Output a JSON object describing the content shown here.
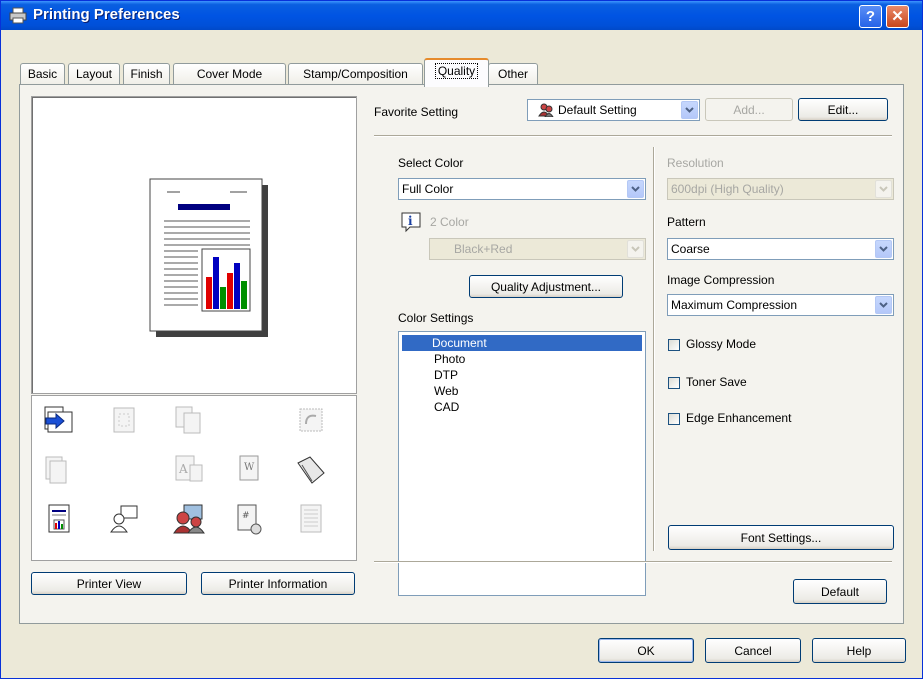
{
  "window": {
    "title": "Printing Preferences",
    "help_btn": "?",
    "close_btn": "✕"
  },
  "tabs": [
    {
      "label": "Basic"
    },
    {
      "label": "Layout"
    },
    {
      "label": "Finish"
    },
    {
      "label": "Cover Mode"
    },
    {
      "label": "Stamp/Composition"
    },
    {
      "label": "Quality",
      "active": true
    },
    {
      "label": "Other"
    }
  ],
  "favorite": {
    "label": "Favorite Setting",
    "value": "Default Setting",
    "add_btn": "Add...",
    "edit_btn": "Edit..."
  },
  "select_color": {
    "label": "Select Color",
    "value": "Full Color"
  },
  "two_color": {
    "label": "2 Color",
    "value": "Black+Red"
  },
  "quality_adjustment_btn": "Quality Adjustment...",
  "color_settings": {
    "label": "Color Settings",
    "items": [
      "Document",
      "Photo",
      "DTP",
      "Web",
      "CAD"
    ],
    "selected": "Document"
  },
  "resolution": {
    "label": "Resolution",
    "value": "600dpi (High Quality)"
  },
  "pattern": {
    "label": "Pattern",
    "value": "Coarse"
  },
  "image_compression": {
    "label": "Image Compression",
    "value": "Maximum Compression"
  },
  "checkboxes": {
    "glossy": "Glossy Mode",
    "toner_save": "Toner Save",
    "edge": "Edge Enhancement"
  },
  "font_settings_btn": "Font Settings...",
  "default_btn": "Default",
  "printer_view_btn": "Printer View",
  "printer_info_btn": "Printer Information",
  "footer": {
    "ok": "OK",
    "cancel": "Cancel",
    "help": "Help"
  },
  "colors": {
    "titlebar": "#0054e3",
    "selection": "#316ac5",
    "tab_highlight": "#e68b2c",
    "dialog_bg": "#ece9d8"
  }
}
